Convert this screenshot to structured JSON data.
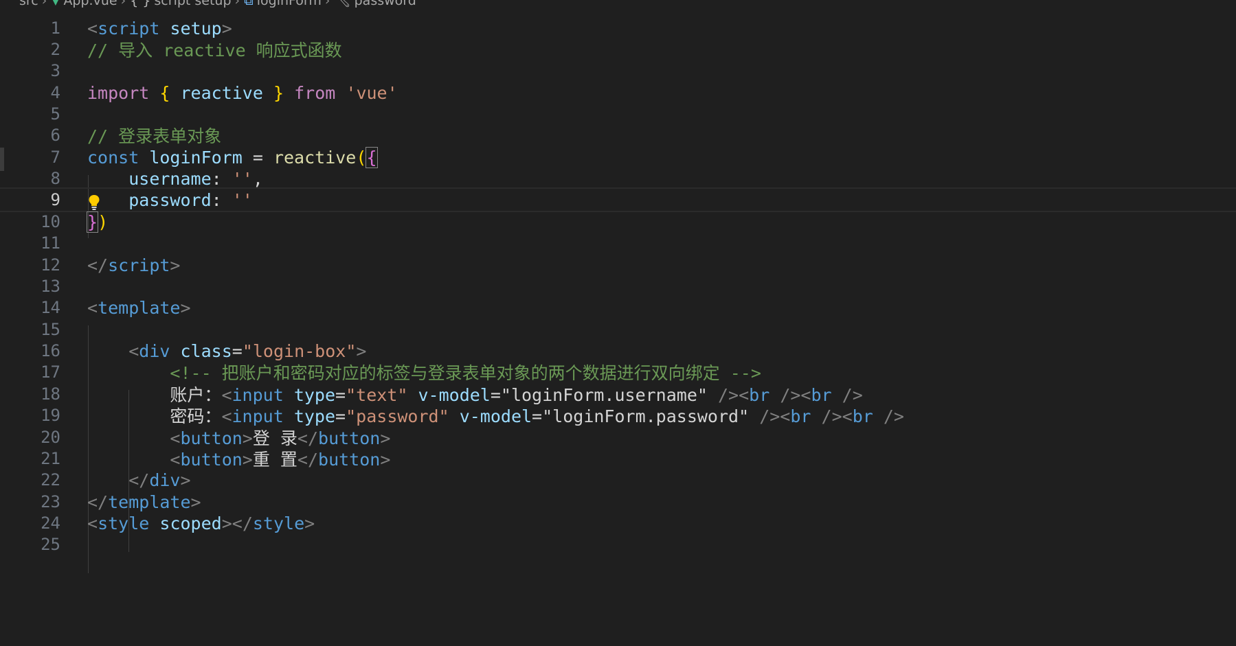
{
  "breadcrumb": {
    "src": "src",
    "file": "App.vue",
    "block": "script setup",
    "symbol": "loginForm",
    "property": "password",
    "sep": ">"
  },
  "editor": {
    "current_line": 9,
    "lines": [
      {
        "n": "1"
      },
      {
        "n": "2"
      },
      {
        "n": "3"
      },
      {
        "n": "4"
      },
      {
        "n": "5"
      },
      {
        "n": "6"
      },
      {
        "n": "7"
      },
      {
        "n": "8"
      },
      {
        "n": "9"
      },
      {
        "n": "10"
      },
      {
        "n": "11"
      },
      {
        "n": "12"
      },
      {
        "n": "13"
      },
      {
        "n": "14"
      },
      {
        "n": "15"
      },
      {
        "n": "16"
      },
      {
        "n": "17"
      },
      {
        "n": "18"
      },
      {
        "n": "19"
      },
      {
        "n": "20"
      },
      {
        "n": "21"
      },
      {
        "n": "22"
      },
      {
        "n": "23"
      },
      {
        "n": "24"
      },
      {
        "n": "25"
      }
    ],
    "code": {
      "l1": {
        "open": "<",
        "tag": "script",
        "sp": " ",
        "attr": "setup",
        "close": ">"
      },
      "l2": {
        "comment": "// 导入 reactive 响应式函数"
      },
      "l4": {
        "kw": "import",
        "sp1": " ",
        "lb": "{",
        "sp2": " ",
        "name": "reactive",
        "sp3": " ",
        "rb": "}",
        "sp4": " ",
        "from": "from",
        "sp5": " ",
        "str": "'vue'"
      },
      "l6": {
        "comment": "// 登录表单对象"
      },
      "l7": {
        "kw": "const",
        "sp1": " ",
        "var": "loginForm",
        "eq": " = ",
        "fn": "reactive",
        "lp": "(",
        "lb": "{"
      },
      "l8": {
        "indent": "    ",
        "prop": "username",
        "colon": ": ",
        "str": "''",
        "comma": ","
      },
      "l9": {
        "indent": "    ",
        "prop": "password",
        "colon": ": ",
        "str": "''"
      },
      "l10": {
        "rb": "}",
        "rp": ")"
      },
      "l12": {
        "open": "</",
        "tag": "script",
        "close": ">"
      },
      "l14": {
        "open": "<",
        "tag": "template",
        "close": ">"
      },
      "l16": {
        "indent": "    ",
        "open": "<",
        "tag": "div",
        "sp": " ",
        "attr": "class",
        "eq": "=",
        "str": "\"login-box\"",
        "close": ">"
      },
      "l17": {
        "indent": "        ",
        "comment": "<!-- 把账户和密码对应的标签与登录表单对象的两个数据进行双向绑定 -->"
      },
      "l18": {
        "indent": "        ",
        "label": "账户：",
        "open": "<",
        "tag": "input",
        "sp1": " ",
        "attr1": "type",
        "eq1": "=",
        "str1": "\"text\"",
        "sp2": " ",
        "attr2": "v-model",
        "eq2": "=",
        "str2": "\"loginForm.username\"",
        "sp3": " ",
        "sc1": "/><",
        "br1": "br",
        "sc2": " /><",
        "br2": "br",
        "sc3": " />"
      },
      "l19": {
        "indent": "        ",
        "label": "密码：",
        "open": "<",
        "tag": "input",
        "sp1": " ",
        "attr1": "type",
        "eq1": "=",
        "str1": "\"password\"",
        "sp2": " ",
        "attr2": "v-model",
        "eq2": "=",
        "str2": "\"loginForm.password\"",
        "sp3": " ",
        "sc1": "/><",
        "br1": "br",
        "sc2": " /><",
        "br2": "br",
        "sc3": " />"
      },
      "l20": {
        "indent": "        ",
        "open": "<",
        "tag": "button",
        "close": ">",
        "text": "登 录",
        "open2": "</",
        "tag2": "button",
        "close2": ">"
      },
      "l21": {
        "indent": "        ",
        "open": "<",
        "tag": "button",
        "close": ">",
        "text": "重 置",
        "open2": "</",
        "tag2": "button",
        "close2": ">"
      },
      "l22": {
        "indent": "    ",
        "open": "</",
        "tag": "div",
        "close": ">"
      },
      "l23": {
        "open": "</",
        "tag": "template",
        "close": ">"
      },
      "l24": {
        "open": "<",
        "tag": "style",
        "sp": " ",
        "attr": "scoped",
        "close": ">",
        "open2": "</",
        "tag2": "style",
        "close2": ">"
      }
    }
  },
  "icons": {
    "vue": "vue-logo-icon",
    "braces": "braces-icon",
    "symbol": "cube-icon",
    "property": "wrench-icon",
    "bulb": "lightbulb-icon"
  },
  "colors": {
    "background": "#1f1f1f",
    "tag": "#569cd6",
    "attr": "#9cdcfe",
    "string": "#ce9178",
    "comment": "#6a9955",
    "keyword": "#c586c0",
    "function": "#dcdcaa",
    "bracket_gold": "#ffd700",
    "bracket_magenta": "#da70d6"
  }
}
